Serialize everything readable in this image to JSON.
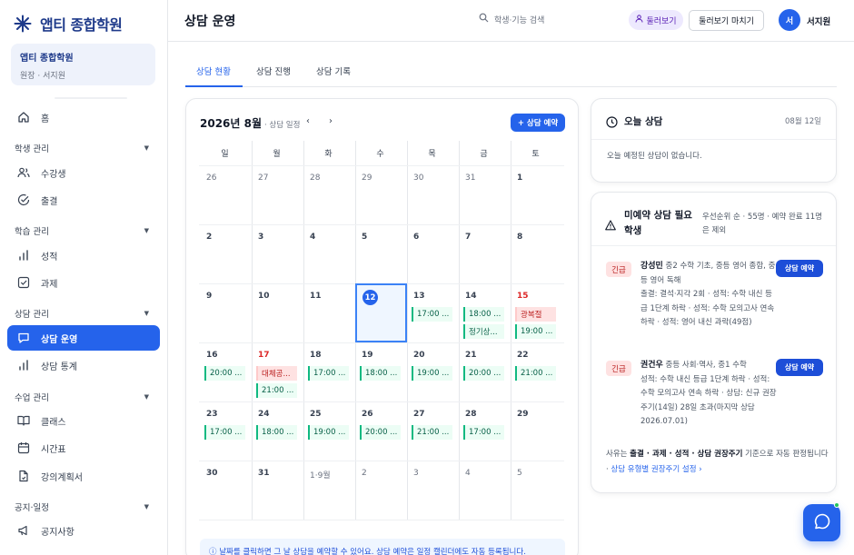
{
  "app": {
    "logo_text": "앱티 종합학원",
    "org_name": "앱티 종합학원",
    "org_sub": "원장 · 서지원"
  },
  "sidebar": {
    "home": "홈",
    "sections": [
      {
        "label": "학생 관리",
        "items": [
          "수강생",
          "출결"
        ]
      },
      {
        "label": "학습 관리",
        "items": [
          "성적",
          "과제"
        ]
      },
      {
        "label": "상담 관리",
        "items": [
          "상담 운영",
          "상담 통계"
        ]
      },
      {
        "label": "수업 관리",
        "items": [
          "클래스",
          "시간표",
          "강의계획서"
        ]
      },
      {
        "label": "공지·일정",
        "items": [
          "공지사항"
        ]
      }
    ],
    "active": "상담 운영"
  },
  "header": {
    "title": "상담 운영",
    "search_placeholder": "학생·기능 검색",
    "preview_label": "둘러보기",
    "stop_preview_label": "둘러보기 마치기",
    "avatar_initial": "서",
    "user_name": "서지원"
  },
  "tabs": [
    "상담 현황",
    "상담 진행",
    "상담 기록"
  ],
  "calendar": {
    "month_label": "2026년 8월",
    "sub_label": "· 상담 일정",
    "prev": "‹",
    "next": "›",
    "add_button": "+ 상담 예약",
    "weekdays": [
      "일",
      "월",
      "화",
      "수",
      "목",
      "금",
      "토"
    ],
    "weeks": [
      [
        {
          "d": "26",
          "muted": true
        },
        {
          "d": "27",
          "muted": true
        },
        {
          "d": "28",
          "muted": true
        },
        {
          "d": "29",
          "muted": true
        },
        {
          "d": "30",
          "muted": true
        },
        {
          "d": "31",
          "muted": true
        },
        {
          "d": "1"
        }
      ],
      [
        {
          "d": "2"
        },
        {
          "d": "3"
        },
        {
          "d": "4"
        },
        {
          "d": "5"
        },
        {
          "d": "6"
        },
        {
          "d": "7"
        },
        {
          "d": "8"
        }
      ],
      [
        {
          "d": "9"
        },
        {
          "d": "10"
        },
        {
          "d": "11"
        },
        {
          "d": "12",
          "today": true
        },
        {
          "d": "13",
          "events": [
            "17:00 ..."
          ]
        },
        {
          "d": "14",
          "events": [
            "18:00 ...",
            "정기상..."
          ]
        },
        {
          "d": "15",
          "red": true,
          "holiday": "광복절",
          "events": [
            "19:00 ..."
          ]
        }
      ],
      [
        {
          "d": "16",
          "events": [
            "20:00 ..."
          ]
        },
        {
          "d": "17",
          "red": true,
          "holiday": "대체공...",
          "events": [
            "21:00 ..."
          ]
        },
        {
          "d": "18",
          "events": [
            "17:00 ..."
          ]
        },
        {
          "d": "19",
          "events": [
            "18:00 ..."
          ]
        },
        {
          "d": "20",
          "events": [
            "19:00 ..."
          ]
        },
        {
          "d": "21",
          "events": [
            "20:00 ..."
          ]
        },
        {
          "d": "22",
          "events": [
            "21:00 ..."
          ]
        }
      ],
      [
        {
          "d": "23",
          "events": [
            "17:00 ..."
          ]
        },
        {
          "d": "24",
          "events": [
            "18:00 ..."
          ]
        },
        {
          "d": "25",
          "events": [
            "19:00 ..."
          ]
        },
        {
          "d": "26",
          "events": [
            "20:00 ..."
          ]
        },
        {
          "d": "27",
          "events": [
            "21:00 ..."
          ]
        },
        {
          "d": "28",
          "events": [
            "17:00 ..."
          ]
        },
        {
          "d": "29"
        }
      ],
      [
        {
          "d": "30"
        },
        {
          "d": "31"
        },
        {
          "d": "1·9월",
          "muted": true
        },
        {
          "d": "2",
          "muted": true
        },
        {
          "d": "3",
          "muted": true
        },
        {
          "d": "4",
          "muted": true
        },
        {
          "d": "5",
          "muted": true
        }
      ]
    ],
    "hint": "ⓘ 날짜를 클릭하면 그 날 상담을 예약할 수 있어요. 상담 예약은 일정 캘린더에도 자동 등록됩니다."
  },
  "today_card": {
    "title": "오늘 상담",
    "date": "08월 12일",
    "empty": "오늘 예정된 상담이 없습니다."
  },
  "unbooked": {
    "title": "미예약 상담 필요 학생",
    "meta": "우선순위 순 · 55명 · 예약 완료 11명은 제외",
    "students": [
      {
        "badge": "긴급",
        "name": "강성민",
        "detail": "중2 수학 기초, 중등 영어 종합, 중등 영어 독해",
        "reason": "출결: 결석·지각 2회 · 성적: 수학 내신 등급 1단계 하락 · 성적: 수학 모의고사 연속 하락 · 성적: 영어 내신 과락(49점)",
        "button": "상담 예약"
      },
      {
        "badge": "긴급",
        "name": "권건우",
        "detail": "중등 사회·역사, 중1 수학",
        "reason": "성적: 수학 내신 등급 1단계 하락 · 성적: 수학 모의고사 연속 하락 · 상담: 신규 권장주기(14일) 28일 초과(마지막 상담 2026.07.01)",
        "button": "상담 예약"
      }
    ],
    "footer_prefix": "사유는",
    "footer_bold": "출결 · 과제 · 성적 · 상담 권장주기",
    "footer_mid": "기준으로 자동 판정됩니다 ·",
    "footer_link": "상담 유형별 권장주기 설정 ›"
  },
  "colors": {
    "accent": "#2563eb",
    "urgent": "#b91c1c",
    "event": "#10b981"
  }
}
